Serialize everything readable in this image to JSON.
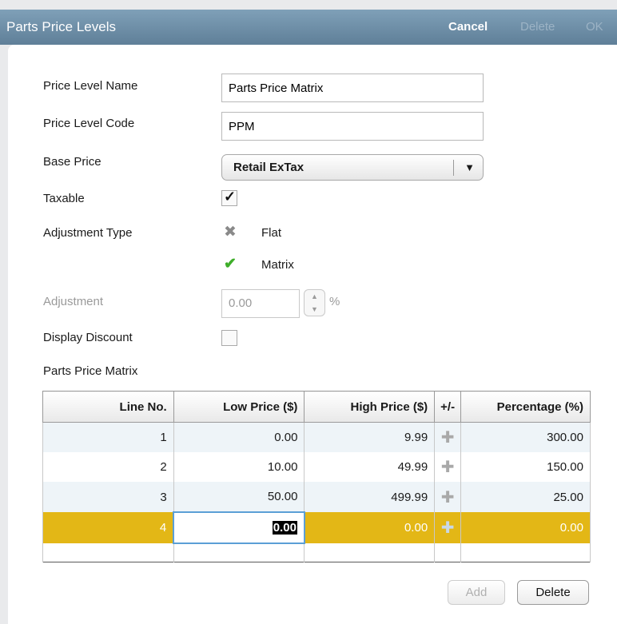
{
  "window": {
    "title": "Parts Price Levels",
    "cancel_label": "Cancel",
    "delete_label": "Delete",
    "ok_label": "OK"
  },
  "form": {
    "price_level_name_label": "Price Level Name",
    "price_level_name_value": "Parts Price Matrix",
    "price_level_code_label": "Price Level Code",
    "price_level_code_value": "PPM",
    "base_price_label": "Base Price",
    "base_price_value": "Retail ExTax",
    "taxable_label": "Taxable",
    "taxable_checked": true,
    "adjustment_type_label": "Adjustment Type",
    "adjustment_type_options": [
      {
        "label": "Flat",
        "selected": false,
        "icon": "x-icon"
      },
      {
        "label": "Matrix",
        "selected": true,
        "icon": "check-icon"
      }
    ],
    "adjustment_label": "Adjustment",
    "adjustment_value": "0.00",
    "adjustment_unit": "%",
    "display_discount_label": "Display Discount",
    "display_discount_checked": false,
    "matrix_label": "Parts Price Matrix"
  },
  "matrix": {
    "columns": [
      "Line No.",
      "Low Price ($)",
      "High Price ($)",
      "+/-",
      "Percentage (%)"
    ],
    "rows": [
      {
        "line": "1",
        "low": "0.00",
        "high": "9.99",
        "pct": "300.00"
      },
      {
        "line": "2",
        "low": "10.00",
        "high": "49.99",
        "pct": "150.00"
      },
      {
        "line": "3",
        "low": "50.00",
        "high": "499.99",
        "pct": "25.00"
      },
      {
        "line": "4",
        "low": "0.00",
        "high": "0.00",
        "pct": "0.00"
      }
    ],
    "selected_row": 4
  },
  "buttons": {
    "add_label": "Add",
    "delete_label": "Delete"
  },
  "colors": {
    "titlebar": "#6f90a8",
    "selected_row": "#e3b716",
    "alt_row": "#eef4f8"
  }
}
